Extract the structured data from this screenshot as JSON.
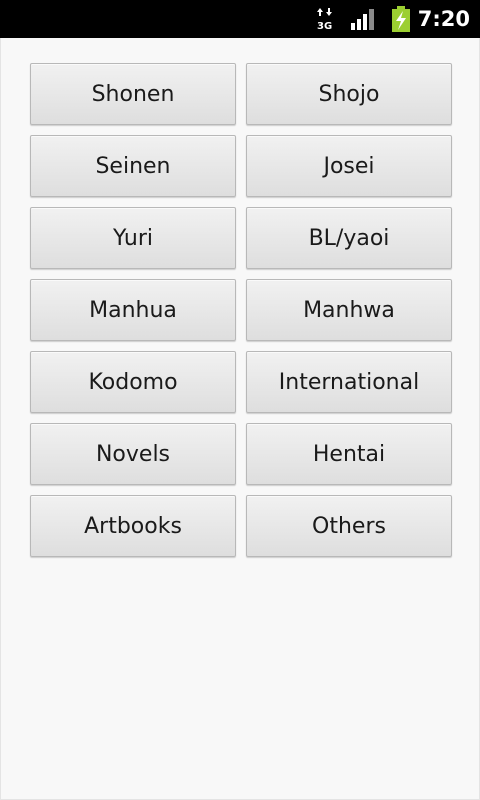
{
  "status_bar": {
    "time": "7:20",
    "data_icon": "3g-data-arrows-icon",
    "signal_icon": "signal-strength-icon",
    "battery_icon": "battery-charging-icon",
    "battery_color": "#9ccf31"
  },
  "genres": [
    {
      "label": "Shonen"
    },
    {
      "label": "Shojo"
    },
    {
      "label": "Seinen"
    },
    {
      "label": "Josei"
    },
    {
      "label": "Yuri"
    },
    {
      "label": "BL/yaoi"
    },
    {
      "label": "Manhua"
    },
    {
      "label": "Manhwa"
    },
    {
      "label": "Kodomo"
    },
    {
      "label": "International"
    },
    {
      "label": "Novels"
    },
    {
      "label": "Hentai"
    },
    {
      "label": "Artbooks"
    },
    {
      "label": "Others"
    }
  ]
}
